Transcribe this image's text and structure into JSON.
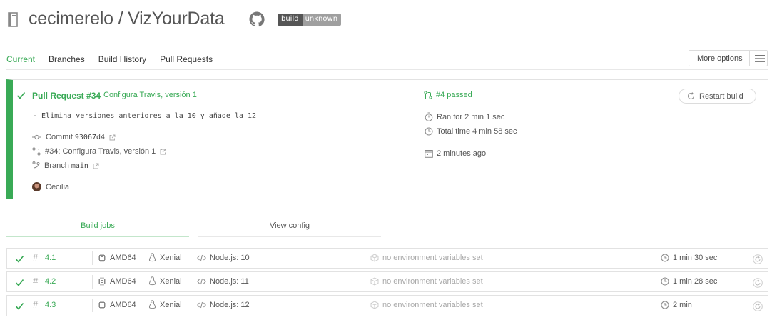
{
  "header": {
    "repo_owner": "cecimerelo",
    "repo_sep": " / ",
    "repo_name": "VizYourData",
    "badge_left": "build",
    "badge_right": "unknown"
  },
  "tabs": [
    "Current",
    "Branches",
    "Build History",
    "Pull Requests"
  ],
  "more_options": "More options",
  "build": {
    "title": "Pull Request #34",
    "subtitle": "Configura Travis, versión 1",
    "message": "- Elimina versiones anteriores a la 10 y añade la 12",
    "commit_label": "Commit",
    "commit_sha": "93067d4",
    "pr_label": "#34: Configura Travis, versión 1",
    "branch_label": "Branch",
    "branch_name": "main",
    "author": "Cecilia",
    "status": "#4 passed",
    "ran_for": "Ran for 2 min 1 sec",
    "total_time": "Total time 4 min 58 sec",
    "finished": "2 minutes ago",
    "restart_label": "Restart build"
  },
  "job_tabs": {
    "build_jobs": "Build jobs",
    "view_config": "View config"
  },
  "jobs": [
    {
      "number": "4.1",
      "arch": "AMD64",
      "os": "Xenial",
      "language": "Node.js: 10",
      "env": "no environment variables set",
      "duration": "1 min 30 sec"
    },
    {
      "number": "4.2",
      "arch": "AMD64",
      "os": "Xenial",
      "language": "Node.js: 11",
      "env": "no environment variables set",
      "duration": "1 min 28 sec"
    },
    {
      "number": "4.3",
      "arch": "AMD64",
      "os": "Xenial",
      "language": "Node.js: 12",
      "env": "no environment variables set",
      "duration": "2 min"
    }
  ],
  "colors": {
    "passed": "#39aa56",
    "text": "#555555",
    "border": "#e2e2e2"
  }
}
